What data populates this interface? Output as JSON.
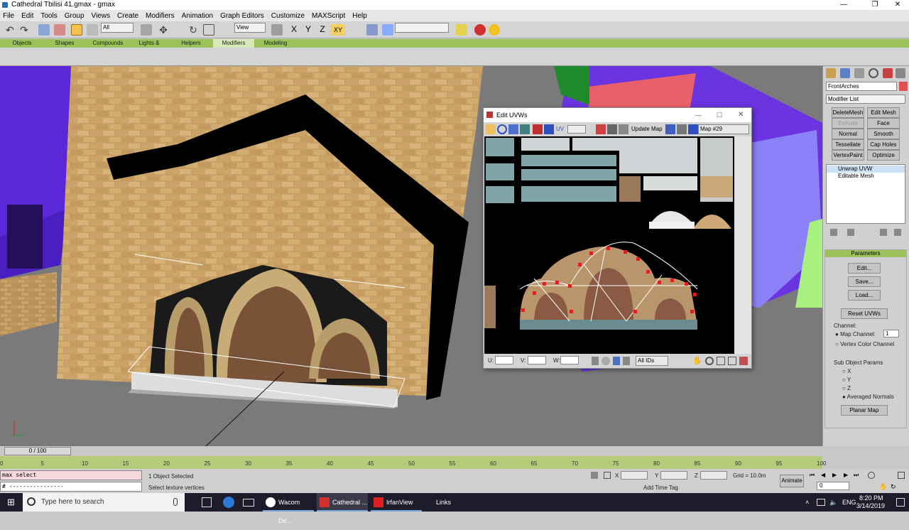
{
  "window": {
    "title": "Cathedral Tbilisi 41.gmax - gmax"
  },
  "menu": [
    "File",
    "Edit",
    "Tools",
    "Group",
    "Views",
    "Create",
    "Modifiers",
    "Animation",
    "Graph Editors",
    "Customize",
    "MAXScript",
    "Help"
  ],
  "toolbar": {
    "selection_filter": "All",
    "ref_coord": "View",
    "constraint_xy": "XY"
  },
  "tabs": [
    "Objects",
    "Shapes",
    "Compounds",
    "Lights & Cameras",
    "Helpers",
    "Modifiers",
    "Modeling"
  ],
  "active_tab": "Modifiers",
  "command_panel": {
    "object_name": "FrontArches",
    "object_color": "#e05050",
    "modifier_list": "Modifier List",
    "modifier_buttons": [
      {
        "label": "DeleteMesh",
        "enabled": true
      },
      {
        "label": "Edit Mesh",
        "enabled": true
      },
      {
        "label": "Extrude",
        "enabled": false
      },
      {
        "label": "Face Extrude",
        "enabled": true
      },
      {
        "label": "Normal",
        "enabled": true
      },
      {
        "label": "Smooth",
        "enabled": true
      },
      {
        "label": "Tessellate",
        "enabled": true
      },
      {
        "label": "Cap Holes",
        "enabled": true
      },
      {
        "label": "VertexPaint",
        "enabled": true
      },
      {
        "label": "Optimize",
        "enabled": true
      }
    ],
    "stack": [
      "Unwrap UVW",
      "Editable Mesh"
    ],
    "parameters": {
      "title": "Parameters",
      "buttons": [
        "Edit...",
        "Save...",
        "Load..."
      ],
      "reset": "Reset UVWs",
      "channel_group": "Channel:",
      "map_channel_label": "Map Channel:",
      "map_channel_value": "1",
      "vertex_color_label": "Vertex Color Channel",
      "sub_object_group": "Sub Object Params",
      "axes": [
        "X",
        "Y",
        "Z",
        "Averaged Normals"
      ],
      "planar_map": "Planar Map"
    }
  },
  "uvw_editor": {
    "title": "Edit UVWs",
    "update_map": "Update Map",
    "uv_label": "UV",
    "map_select": "Map #29",
    "u_label": "U:",
    "v_label": "V:",
    "w_label": "W:",
    "ids_select": "All IDs"
  },
  "timeline": {
    "frame": "0 / 100"
  },
  "ruler_ticks": [
    "0",
    "5",
    "10",
    "15",
    "20",
    "25",
    "30",
    "35",
    "40",
    "45",
    "50",
    "55",
    "60",
    "65",
    "70",
    "75",
    "80",
    "85",
    "90",
    "95",
    "100"
  ],
  "status": {
    "maxscript_line1": "max select",
    "maxscript_line2": "# ----------------",
    "selected": "1 Object Selected",
    "prompt": "Select texture vertices",
    "x_label": "X",
    "y_label": "Y",
    "z_label": "Z",
    "grid": "Grid = 10.0m",
    "add_time_tag": "Add Time Tag",
    "animate": "Animate",
    "frame_value": "0"
  },
  "taskbar": {
    "search_placeholder": "Type here to search",
    "apps": [
      "Wacom De...",
      "Cathedral ...",
      "IrfanView",
      "Links"
    ],
    "lang": "ENG",
    "time": "8:20 PM",
    "date": "3/14/2019"
  }
}
